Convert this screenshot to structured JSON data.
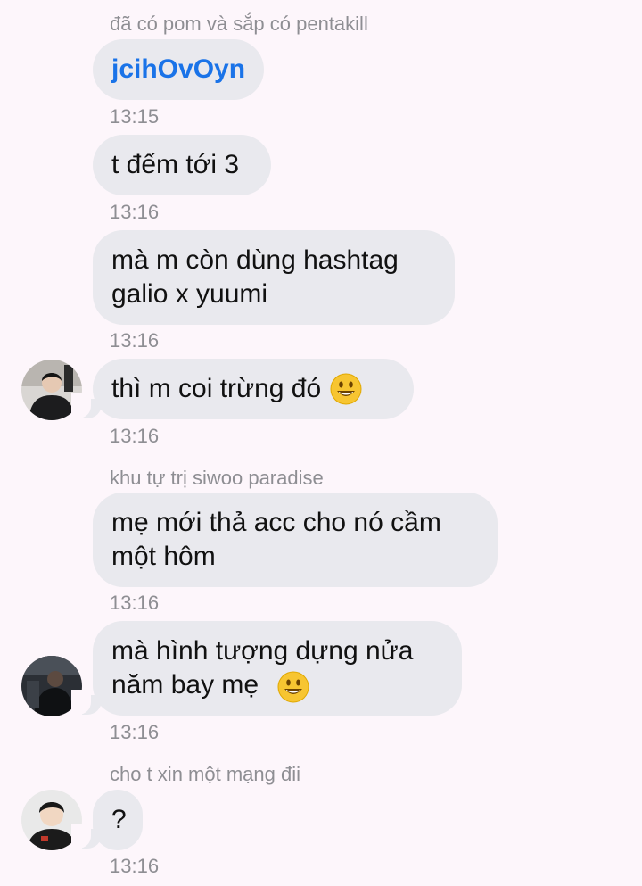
{
  "messages": [
    {
      "sender": "đã có pom và sắp có pentakill",
      "text": "jcihOvOyn",
      "time": "13:15"
    },
    {
      "text": "t đếm tới 3",
      "time": "13:16"
    },
    {
      "text": "mà m còn dùng hashtag\ngalio x yuumi",
      "time": "13:16"
    },
    {
      "text": "thì m coi trừng đó",
      "time": "13:16",
      "emoji": "smiley-emoji"
    },
    {
      "sender": "khu tự trị siwoo paradise",
      "text": "mẹ mới thả acc cho nó cầm\nmột hôm",
      "time": "13:16"
    },
    {
      "text": "mà hình tượng dựng nửa\nnăm bay mẹ",
      "time": "13:16",
      "emoji": "smiley-emoji"
    },
    {
      "sender": "cho t xin một mạng đii",
      "text": "?",
      "time": "13:16"
    }
  ]
}
